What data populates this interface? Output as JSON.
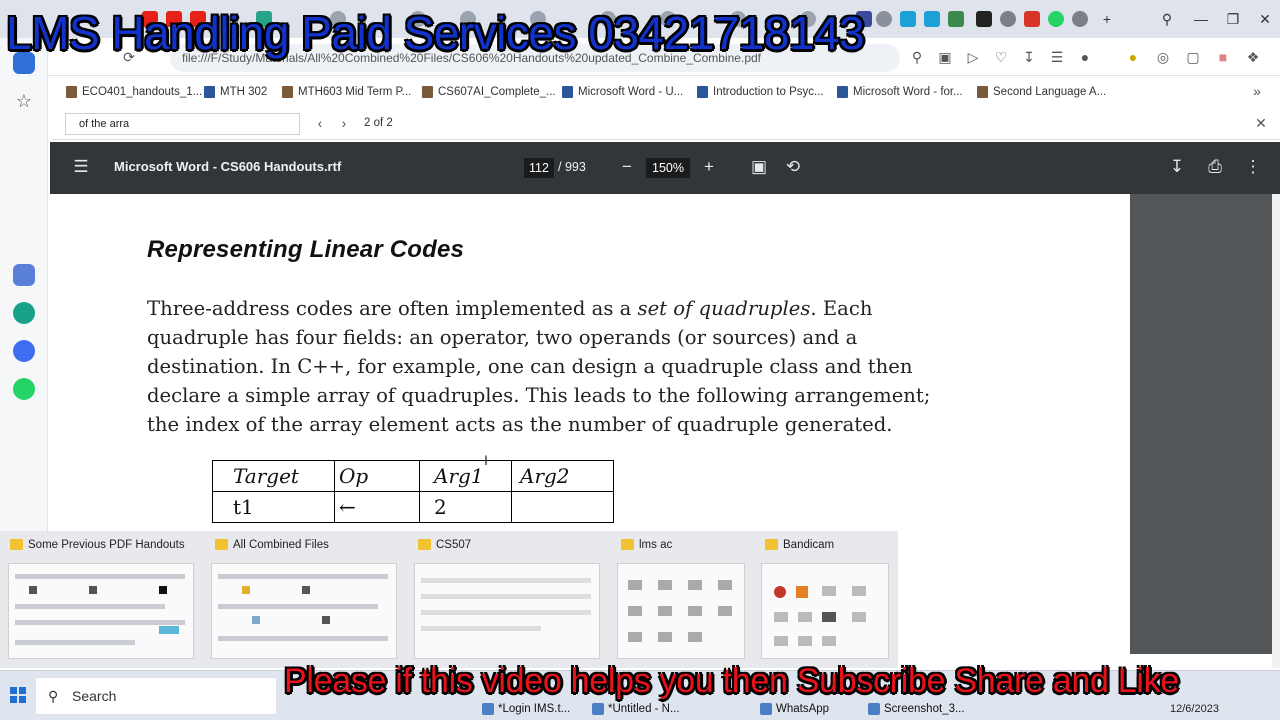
{
  "overlay": {
    "top_caption": "LMS Handling Paid Services 03421718143",
    "bottom_caption": "Please if this video helps you then Subscribe Share and Like"
  },
  "browser": {
    "url": "file:///F/Study/Materials/All%20Combined%20Files/CS606%20Handouts%20updated_Combine_Combine.pdf",
    "bookmarks": [
      "ECO401_handouts_1...",
      "MTH 302",
      "MTH603 Mid Term P...",
      "CS607AI_Complete_...",
      "Microsoft Word - U...",
      "Introduction to Psyc...",
      "Microsoft Word - for...",
      "Second Language A..."
    ],
    "find": {
      "query": "of the arra",
      "result_count": "2 of 2"
    }
  },
  "pdf_viewer": {
    "title": "Microsoft Word - CS606 Handouts.rtf",
    "current_page": "112",
    "total_pages": "/ 993",
    "zoom": "150%"
  },
  "document": {
    "heading": "Representing Linear Codes",
    "para_part1": "Three-address codes are often implemented as a ",
    "para_emph": "set of quadruples",
    "para_part2": ". Each quadruple has four fields: an operator, two operands (or sources) and a destination. In C++, for example, one can design a quadruple class and then declare a simple array of quadruples. This leads to the following arrangement; the index of the array element acts as the number of quadruple generated.",
    "table": {
      "headers": [
        "Target",
        "Op",
        "Arg1",
        "Arg2"
      ],
      "rows": [
        [
          "t1",
          "←",
          "2",
          ""
        ]
      ]
    }
  },
  "thumbnails": [
    "Some Previous  PDF Handouts",
    "All Combined Files",
    "CS507",
    "lms ac",
    "Bandicam"
  ],
  "taskbar": {
    "search_label": "Search",
    "apps": [
      "*Login IMS.t...",
      "*Untitled - N...",
      "WhatsApp",
      "Screenshot_3..."
    ],
    "date": "12/6/2023"
  }
}
